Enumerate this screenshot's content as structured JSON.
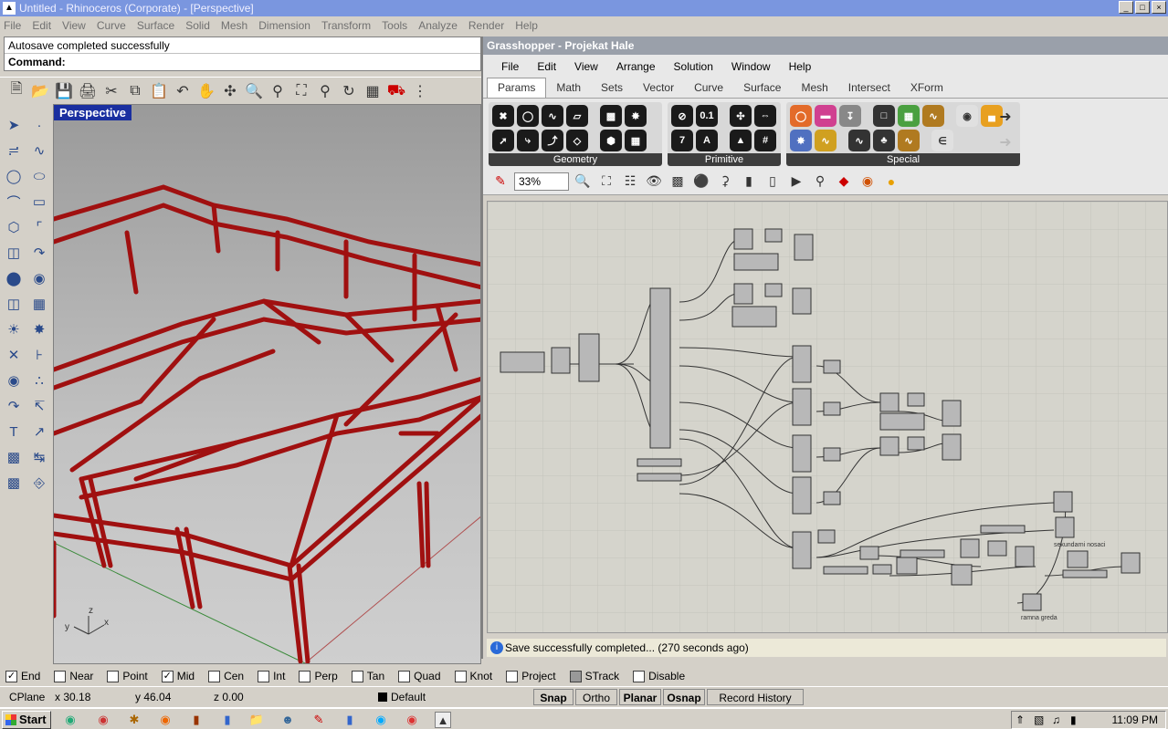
{
  "window": {
    "title": "Untitled - Rhinoceros (Corporate) - [Perspective]",
    "controls": [
      "_",
      "□",
      "×"
    ]
  },
  "menu": [
    "File",
    "Edit",
    "View",
    "Curve",
    "Surface",
    "Solid",
    "Mesh",
    "Dimension",
    "Transform",
    "Tools",
    "Analyze",
    "Render",
    "Help"
  ],
  "command": {
    "history": "Autosave completed successfully",
    "prompt": "Command:"
  },
  "viewport": {
    "label": "Perspective",
    "axes": {
      "z": "z",
      "y": "y",
      "x": "x"
    }
  },
  "grasshopper": {
    "title": "Grasshopper - Projekat Hale",
    "menu": [
      "File",
      "Edit",
      "View",
      "Arrange",
      "Solution",
      "Window",
      "Help"
    ],
    "tabs": [
      "Params",
      "Math",
      "Sets",
      "Vector",
      "Curve",
      "Surface",
      "Mesh",
      "Intersect",
      "XForm"
    ],
    "active_tab": "Params",
    "panels": [
      {
        "caption": "Geometry"
      },
      {
        "caption": "Primitive"
      },
      {
        "caption": "Special"
      }
    ],
    "primitive_labels": [
      "0.1",
      "7",
      "A"
    ],
    "zoom": "33%",
    "canvas_labels": [
      "sekundarni nosaci",
      "ramna greda"
    ],
    "status": "Save successfully completed... (270 seconds ago)"
  },
  "osnaps": [
    {
      "label": "End",
      "checked": true
    },
    {
      "label": "Near",
      "checked": false
    },
    {
      "label": "Point",
      "checked": false
    },
    {
      "label": "Mid",
      "checked": true
    },
    {
      "label": "Cen",
      "checked": false
    },
    {
      "label": "Int",
      "checked": false
    },
    {
      "label": "Perp",
      "checked": false
    },
    {
      "label": "Tan",
      "checked": false
    },
    {
      "label": "Quad",
      "checked": false
    },
    {
      "label": "Knot",
      "checked": false
    },
    {
      "label": "Project",
      "checked": false
    },
    {
      "label": "STrack",
      "checked": false
    },
    {
      "label": "Disable",
      "checked": false
    }
  ],
  "status": {
    "cplane": "CPlane",
    "x": "x 30.18",
    "y": "y 46.04",
    "z": "z 0.00",
    "layer": "Default",
    "panes": [
      "Snap",
      "Ortho",
      "Planar",
      "Osnap",
      "Record History"
    ]
  },
  "taskbar": {
    "start": "Start",
    "clock": "11:09 PM"
  },
  "colors": {
    "frame_red": "#a01010",
    "viewport_label_bg": "#1a2fa0"
  }
}
